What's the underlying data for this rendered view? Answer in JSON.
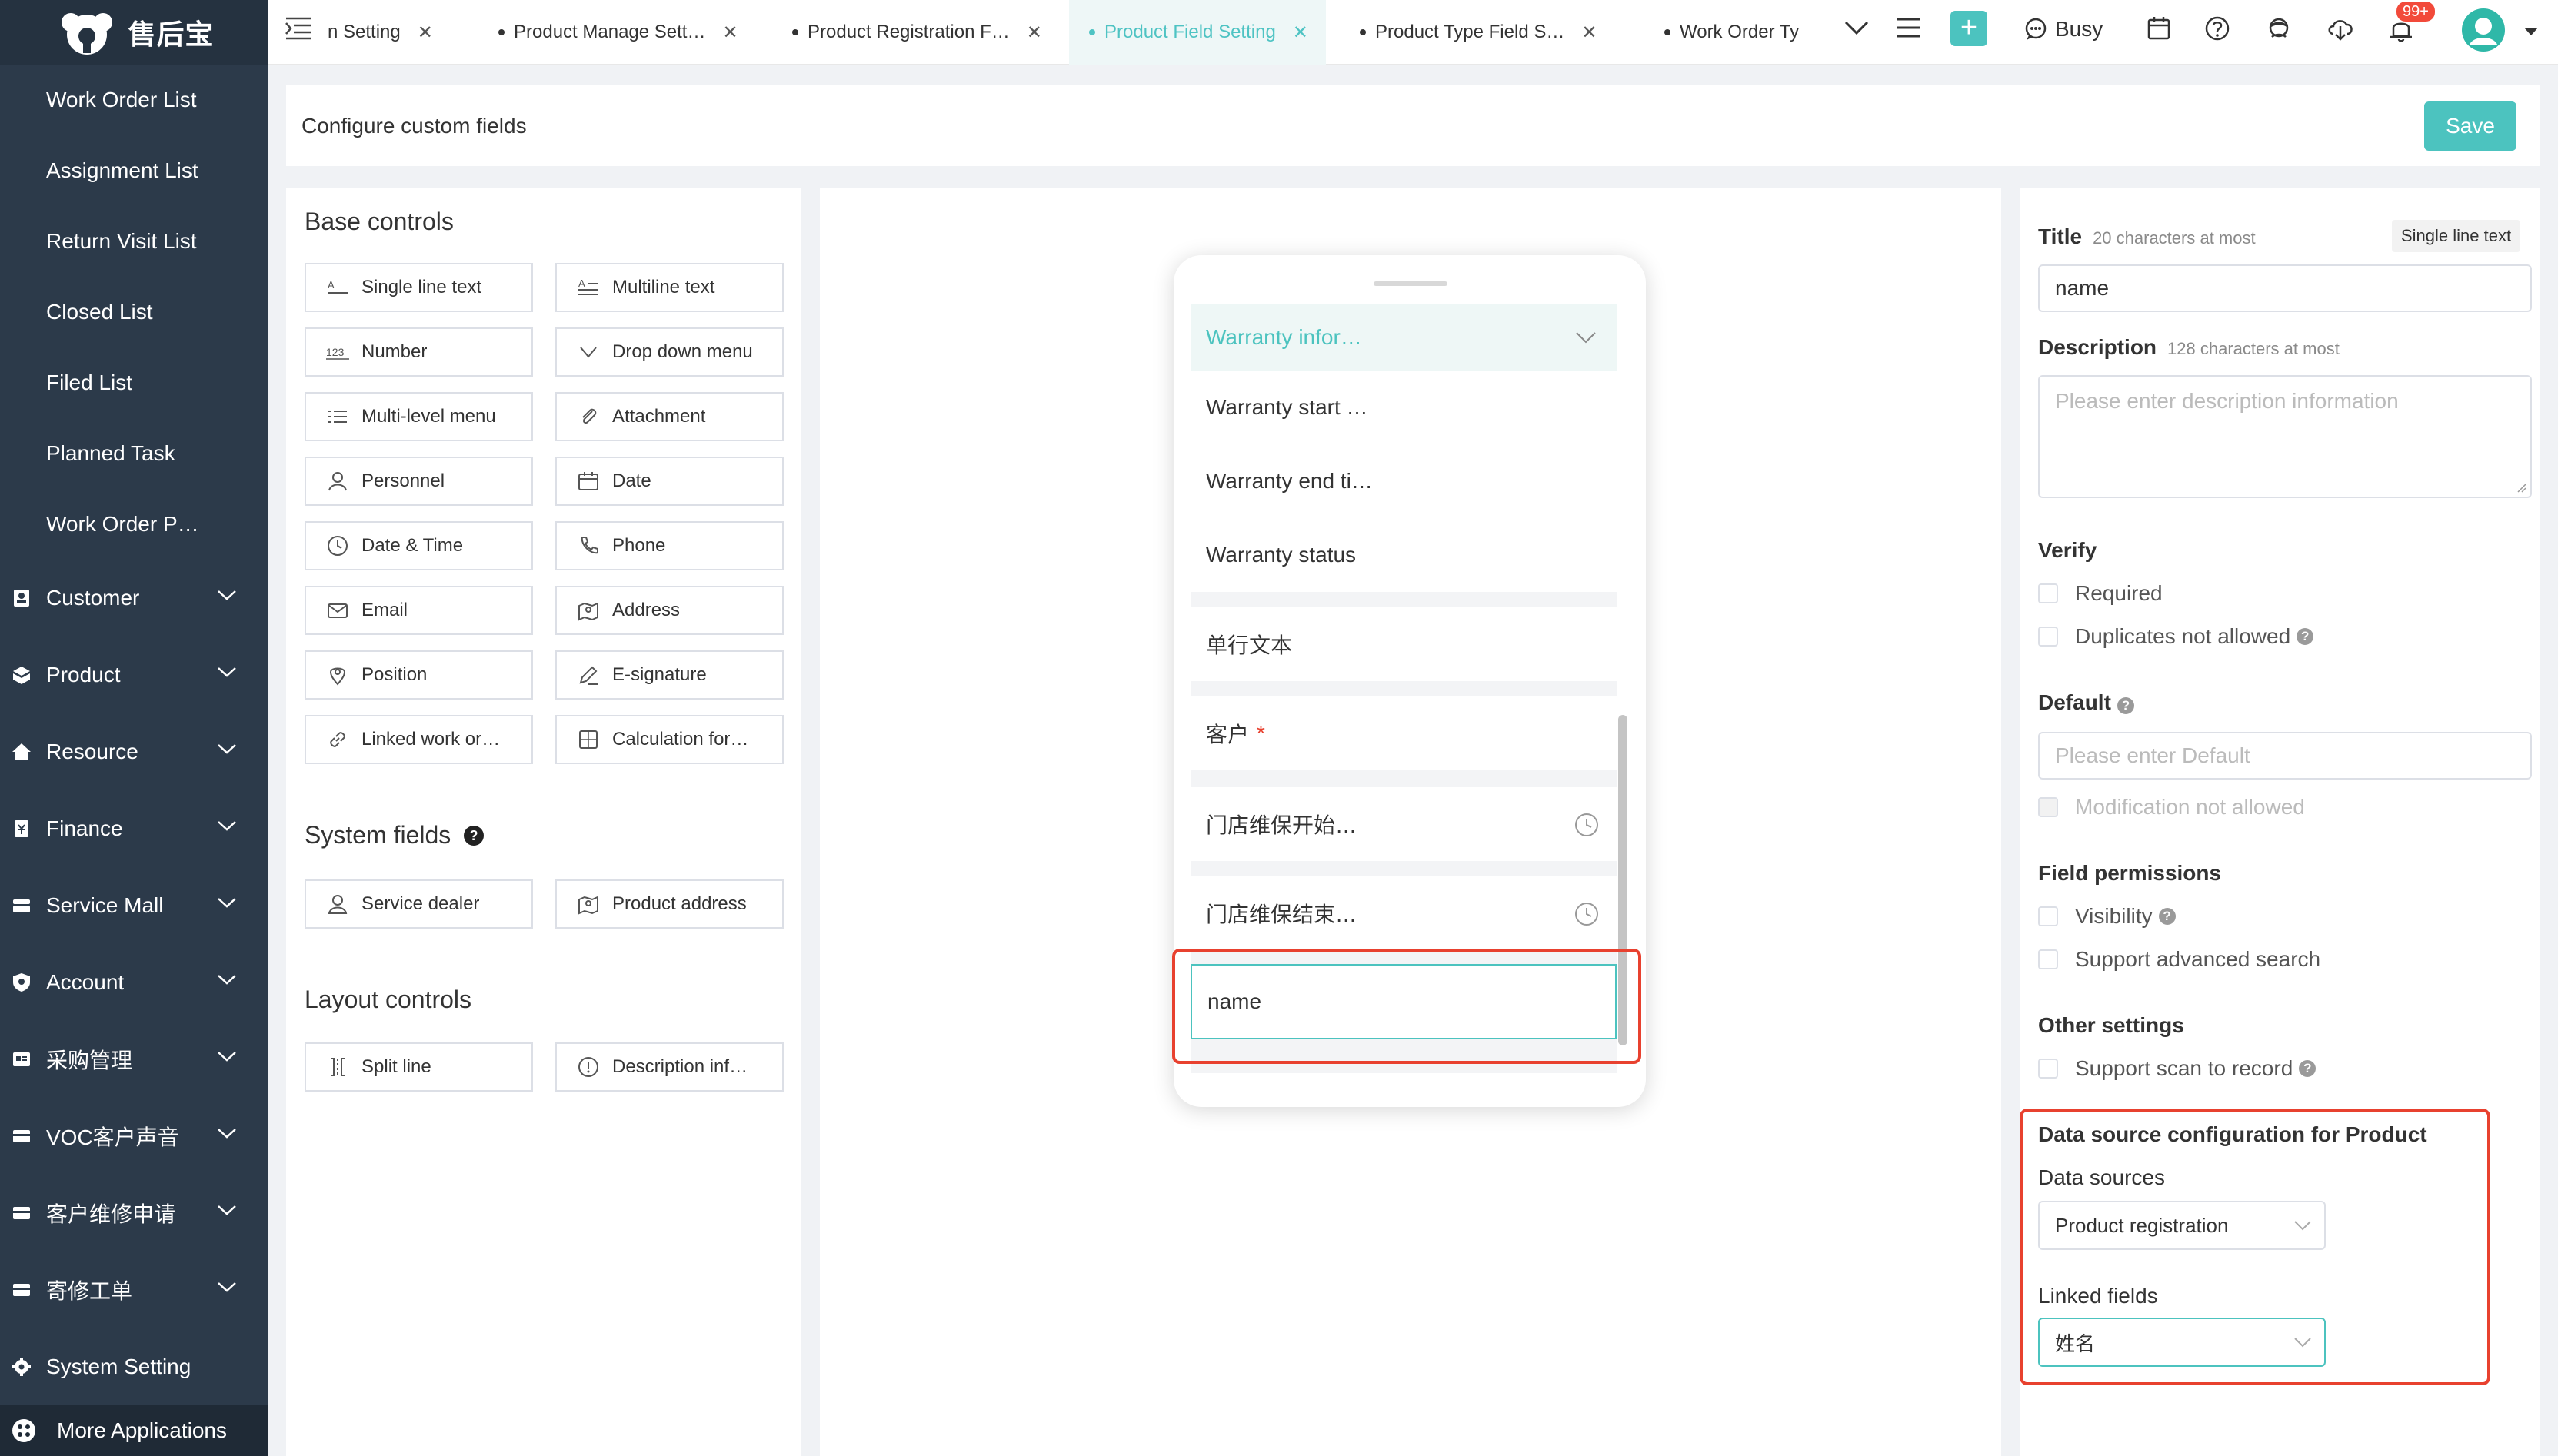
{
  "brand": {
    "logo_text": "售后宝"
  },
  "sidebar": {
    "sub_items": [
      {
        "label": "Work Order List"
      },
      {
        "label": "Assignment List"
      },
      {
        "label": "Return Visit List"
      },
      {
        "label": "Closed List"
      },
      {
        "label": "Filed List"
      },
      {
        "label": "Planned Task"
      },
      {
        "label": "Work Order P…"
      }
    ],
    "groups": [
      {
        "label": "Customer",
        "icon": "customer-icon"
      },
      {
        "label": "Product",
        "icon": "product-icon"
      },
      {
        "label": "Resource",
        "icon": "resource-icon"
      },
      {
        "label": "Finance",
        "icon": "finance-icon"
      },
      {
        "label": "Service Mall",
        "icon": "service-mall-icon"
      },
      {
        "label": "Account",
        "icon": "account-icon"
      },
      {
        "label": "采购管理",
        "icon": "purchase-icon"
      },
      {
        "label": "VOC客户声音",
        "icon": "voc-icon"
      },
      {
        "label": "客户维修申请",
        "icon": "repair-icon"
      },
      {
        "label": "寄修工单",
        "icon": "mail-repair-icon"
      }
    ],
    "system_setting": "System Setting",
    "more_apps": "More Applications"
  },
  "tabs": [
    {
      "label": "n Setting"
    },
    {
      "label": "Product Manage Sett…"
    },
    {
      "label": "Product Registration F…"
    },
    {
      "label": "Product Field Setting",
      "active": true
    },
    {
      "label": "Product Type Field S…"
    },
    {
      "label": "Work Order Ty"
    }
  ],
  "topbar": {
    "status": "Busy",
    "badge": "99+"
  },
  "header": {
    "title": "Configure custom fields",
    "save_label": "Save"
  },
  "base_controls": {
    "title": "Base controls",
    "items": [
      {
        "label": "Single line text",
        "icon": "single-line-icon"
      },
      {
        "label": "Multiline text",
        "icon": "multiline-icon"
      },
      {
        "label": "Number",
        "icon": "number-icon"
      },
      {
        "label": "Drop down menu",
        "icon": "chevron-down-icon"
      },
      {
        "label": "Multi-level menu",
        "icon": "list-icon"
      },
      {
        "label": "Attachment",
        "icon": "paperclip-icon"
      },
      {
        "label": "Personnel",
        "icon": "person-icon"
      },
      {
        "label": "Date",
        "icon": "calendar-icon"
      },
      {
        "label": "Date & Time",
        "icon": "clock-icon"
      },
      {
        "label": "Phone",
        "icon": "phone-icon"
      },
      {
        "label": "Email",
        "icon": "mail-icon"
      },
      {
        "label": "Address",
        "icon": "map-icon"
      },
      {
        "label": "Position",
        "icon": "pin-icon"
      },
      {
        "label": "E-signature",
        "icon": "pen-icon"
      },
      {
        "label": "Linked work or…",
        "icon": "link-icon"
      },
      {
        "label": "Calculation for…",
        "icon": "calculator-icon"
      }
    ]
  },
  "system_fields": {
    "title": "System fields",
    "items": [
      {
        "label": "Service dealer",
        "icon": "dealer-icon"
      },
      {
        "label": "Product address",
        "icon": "map-icon"
      }
    ]
  },
  "layout_controls": {
    "title": "Layout controls",
    "items": [
      {
        "label": "Split line",
        "icon": "split-line-icon"
      },
      {
        "label": "Description inf…",
        "icon": "info-icon"
      }
    ]
  },
  "preview": {
    "group_header": "Warranty infor…",
    "group_fields": [
      {
        "label": "Warranty start …"
      },
      {
        "label": "Warranty end ti…"
      },
      {
        "label": "Warranty status"
      }
    ],
    "fields": [
      {
        "label": "单行文本"
      },
      {
        "label": "客户",
        "required_mark": "*"
      },
      {
        "label": "门店维保开始…"
      },
      {
        "label": "门店维保结束…"
      }
    ],
    "selected_field": "name"
  },
  "props": {
    "title_label": "Title",
    "title_hint": "20 characters at most",
    "type_tag": "Single line text",
    "title_value": "name",
    "desc_label": "Description",
    "desc_hint": "128 characters at most",
    "desc_placeholder": "Please enter description information",
    "verify_label": "Verify",
    "required_label": "Required",
    "duplicates_label": "Duplicates not allowed",
    "default_label": "Default",
    "default_placeholder": "Please enter Default",
    "modification_label": "Modification not allowed",
    "permissions_label": "Field permissions",
    "visibility_label": "Visibility",
    "adv_search_label": "Support advanced search",
    "other_label": "Other settings",
    "scan_label": "Support scan to record",
    "ds_title": "Data source configuration for Product",
    "ds_label": "Data sources",
    "ds_value": "Product registration",
    "linked_label": "Linked fields",
    "linked_value": "姓名"
  },
  "colors": {
    "accent": "#4cc3bf",
    "sidebar": "#2c3a4a",
    "highlight": "#e8412f"
  }
}
